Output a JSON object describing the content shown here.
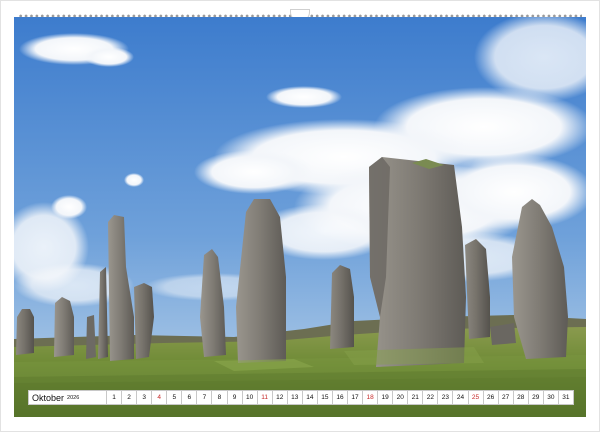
{
  "calendar": {
    "month": "Oktober",
    "year": "2026",
    "days": [
      "1",
      "2",
      "3",
      "4",
      "5",
      "6",
      "7",
      "8",
      "9",
      "10",
      "11",
      "12",
      "13",
      "14",
      "15",
      "16",
      "17",
      "18",
      "19",
      "20",
      "21",
      "22",
      "23",
      "24",
      "25",
      "26",
      "27",
      "28",
      "29",
      "30",
      "31"
    ],
    "sundays": [
      "4",
      "11",
      "18",
      "25"
    ]
  },
  "photo": {
    "subject": "Standing stones under blue sky with white clouds on a grassy moor"
  },
  "colors": {
    "sky_top": "#3f7fcf",
    "sky_bottom": "#b9d3ea",
    "grass": "#6e8c3a",
    "stone": "#7d7a74",
    "sunday_text": "#c62828"
  }
}
